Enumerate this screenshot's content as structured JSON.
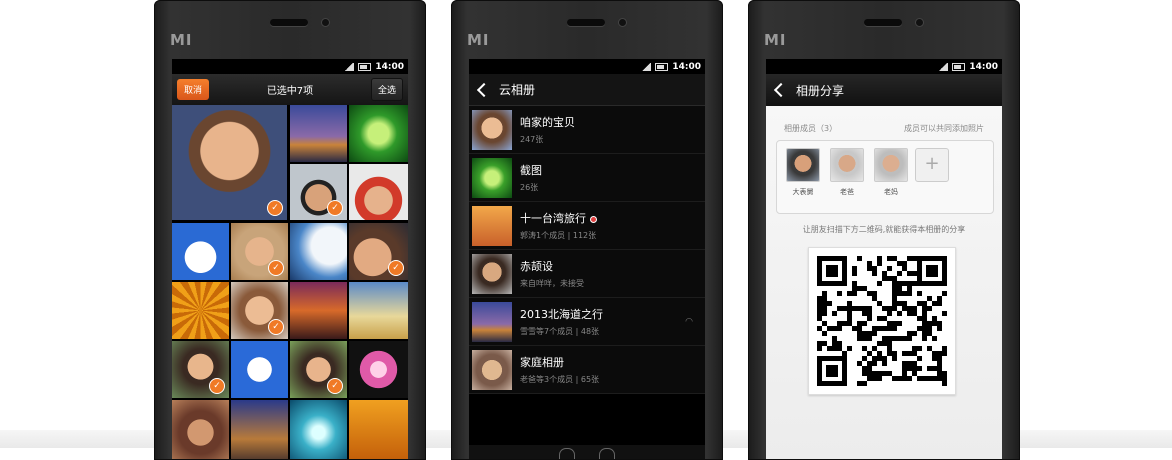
{
  "status_time": "14:00",
  "brand": "MI",
  "selection_screen": {
    "cancel_label": "取消",
    "title": "已选中7项",
    "select_all_label": "全选"
  },
  "albums_screen": {
    "title": "云相册",
    "albums": [
      {
        "name": "咱家的宝贝",
        "meta": "247张",
        "badge": false
      },
      {
        "name": "截图",
        "meta": "26张",
        "badge": false
      },
      {
        "name": "十一台湾旅行",
        "meta": "郭涛1个成员 | 112张",
        "badge": true
      },
      {
        "name": "赤颉设",
        "meta": "来自咩咩，未接受",
        "badge": false
      },
      {
        "name": "2013北海道之行",
        "meta": "雪雪等7个成员 | 48张",
        "badge": false
      },
      {
        "name": "家庭相册",
        "meta": "老爸等3个成员 | 65张",
        "badge": false
      }
    ]
  },
  "share_screen": {
    "title": "相册分享",
    "members_label": "相册成员（3）",
    "members_hint": "成员可以共同添加照片",
    "members": [
      {
        "name": "大表舅"
      },
      {
        "name": "老爸"
      },
      {
        "name": "老妈"
      }
    ],
    "qr_hint": "让朋友扫描下方二维码,就能获得本相册的分享"
  },
  "colors": {
    "accent": "#f07a26",
    "screen_bg": "#000000",
    "share_bg": "#f3f3f3"
  }
}
